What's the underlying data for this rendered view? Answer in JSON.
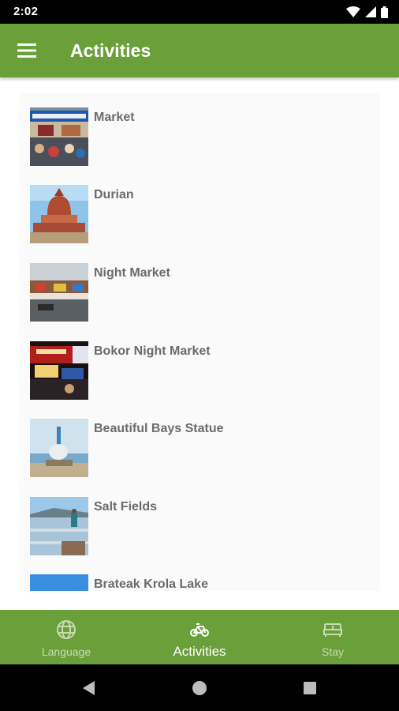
{
  "status_bar": {
    "time": "2:02"
  },
  "app_bar": {
    "title": "Activities",
    "menu_icon": "menu-icon"
  },
  "activities": [
    {
      "title": "Market",
      "thumbnail": "market-photo"
    },
    {
      "title": "Durian",
      "thumbnail": "durian-monument-photo"
    },
    {
      "title": "Night Market",
      "thumbnail": "night-market-photo"
    },
    {
      "title": "Bokor Night Market",
      "thumbnail": "bokor-night-market-photo"
    },
    {
      "title": "Beautiful Bays Statue",
      "thumbnail": "beautiful-bays-statue-photo"
    },
    {
      "title": "Salt Fields",
      "thumbnail": "salt-fields-photo"
    },
    {
      "title": "Brateak Krola Lake",
      "thumbnail": "brateak-krola-lake-photo"
    }
  ],
  "bottom_nav": {
    "items": [
      {
        "label": "Language",
        "icon": "globe-icon",
        "active": false
      },
      {
        "label": "Activities",
        "icon": "bicycle-icon",
        "active": true
      },
      {
        "label": "Stay",
        "icon": "bed-icon",
        "active": false
      }
    ]
  },
  "system_nav": {
    "back": "back-icon",
    "home": "home-icon",
    "recents": "recents-icon"
  },
  "colors": {
    "primary": "#6a9f3a",
    "item_text": "#6b6b6b",
    "inactive_nav": "#c8dcb2"
  }
}
